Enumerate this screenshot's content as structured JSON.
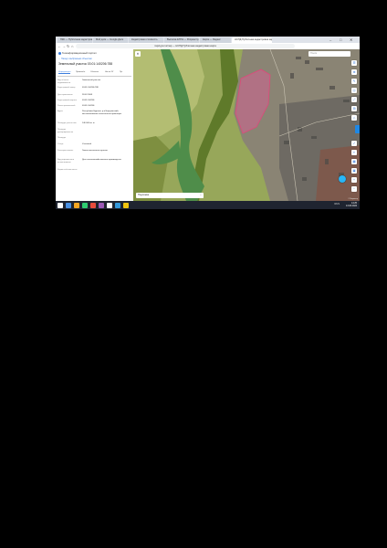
{
  "browser": {
    "tabs": [
      {
        "label": "ПКК — Публичная кадастровая карта"
      },
      {
        "label": "Мой диск — Google Диск"
      },
      {
        "label": "Кадастровая стоимость"
      },
      {
        "label": "Выписка ЕГРН — Росреестр"
      },
      {
        "label": "Карта — Яндекс"
      },
      {
        "label": "НСПД Публичная кадастровая карта"
      }
    ],
    "active_tab_index": 5,
    "url": "nspd.gov.ru/map",
    "page_title": "НСПД Публичная кадастровая карта",
    "controls": {
      "minimize": "–",
      "maximize": "□",
      "close": "✕"
    },
    "nav": {
      "back": "←",
      "forward": "→",
      "reload": "↻",
      "home": "⌂"
    }
  },
  "panel": {
    "brand": "Геоинформационный портал",
    "breadcrumb": "← Назад к выбранным объектам",
    "title": "Земельный участок 03:01:140206:788",
    "tabs": [
      "Информация",
      "Правообл.",
      "Объекты",
      "Части ЗУ",
      "Пр."
    ],
    "active_tab": 0,
    "attributes": [
      {
        "label": "Вид объекта недвижимости",
        "value": "Земельный участок"
      },
      {
        "label": "Кадастровый номер",
        "value": "03:01:140206:788"
      },
      {
        "label": "Дата присвоения",
        "value": "28.02.2008"
      },
      {
        "label": "Кадастровый квартал",
        "value": "03:01:140206"
      },
      {
        "label": "Ранее присвоенный",
        "value": "03:01:140206"
      },
      {
        "label": "Адрес",
        "value": "Республика Бурятия, р-н Баргузинский, местоположение относительно ориентира"
      },
      {
        "label": "Площадь уточненная",
        "value": "146 000 кв. м"
      },
      {
        "label": "Площадь декларированная",
        "value": ""
      },
      {
        "label": "Площадь",
        "value": ""
      },
      {
        "label": "Статус",
        "value": "Учтенный"
      },
      {
        "label": "Категория земель",
        "value": "Земли населенных пунктов"
      },
      {
        "label": "Вид разрешенного использования",
        "value": "Для сельскохозяйственного производства"
      },
      {
        "label": "Форма собственности",
        "value": ""
      }
    ]
  },
  "map": {
    "search_placeholder": "Поиск",
    "close_icon": "✕",
    "layer_select": "Подложка",
    "layer_chevron": "⌄",
    "zoom_in": "+",
    "zoom_out": "−",
    "tools": [
      "☰",
      "⊕",
      "✎",
      "◎",
      "⤢",
      "⊞",
      "△",
      "✓",
      "⌖",
      "▦",
      "▣",
      "⬚"
    ],
    "copyright": "© Росреестр",
    "parcel_color": "#e05a9a"
  },
  "taskbar": {
    "time": "14:25",
    "date": "13.03.2024",
    "tray": "RUS",
    "icon_colors": [
      "#ffffff",
      "#4a90e2",
      "#f5a623",
      "#2ecc71",
      "#e74c3c",
      "#9b59b6",
      "#ffffff",
      "#3498db",
      "#f1c40f"
    ]
  }
}
